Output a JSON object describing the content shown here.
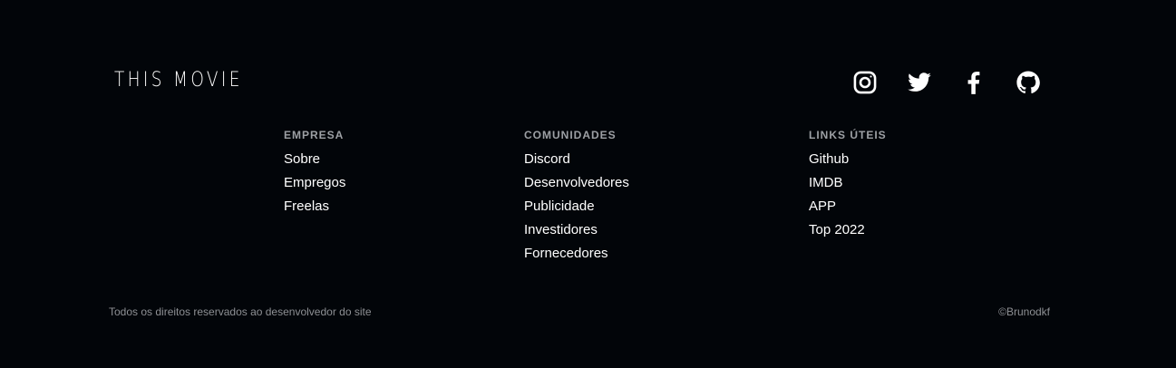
{
  "footer": {
    "brand": "THIS MOVIE",
    "socials": [
      {
        "icon": "instagram-icon"
      },
      {
        "icon": "twitter-icon"
      },
      {
        "icon": "facebook-icon"
      },
      {
        "icon": "github-icon"
      }
    ],
    "columns": {
      "empresa": {
        "title": "EMPRESA",
        "links": [
          "Sobre",
          "Empregos",
          "Freelas"
        ]
      },
      "comunidades": {
        "title": "COMUNIDADES",
        "links": [
          "Discord",
          "Desenvolvedores",
          "Publicidade",
          "Investidores",
          "Fornecedores"
        ]
      },
      "links_uteis": {
        "title": "LINKS ÚTEIS",
        "links": [
          "Github",
          "IMDB",
          "APP",
          "Top 2022"
        ]
      }
    },
    "rights": "Todos os direitos reservados ao desenvolvedor do site",
    "credit": "©Brunodkf"
  },
  "colors": {
    "background": "#020509",
    "heading": "#9da0a4",
    "link": "#ffffff",
    "muted": "#8e9094"
  }
}
